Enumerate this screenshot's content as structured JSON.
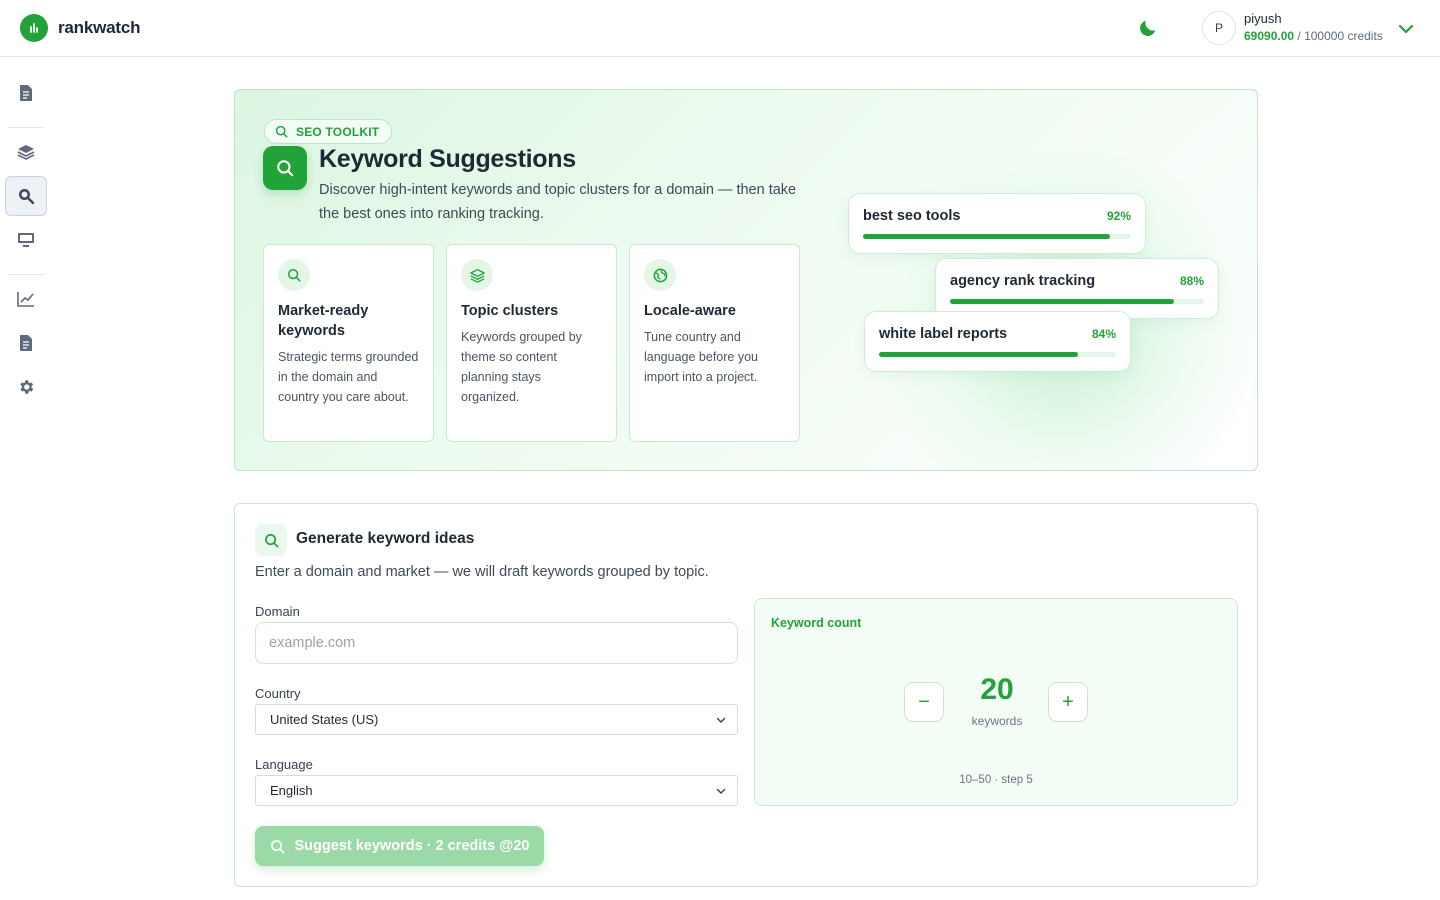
{
  "header": {
    "brand": "rankwatch",
    "user": {
      "initial": "P",
      "name": "piyush",
      "credits_used": "69090.00",
      "credits_total": "/ 100000 credits"
    }
  },
  "sidebar": {
    "items": [
      {
        "icon": "document-icon"
      },
      {
        "icon": "layers-icon"
      },
      {
        "icon": "keyword-search-icon",
        "active": true
      },
      {
        "icon": "monitor-icon"
      },
      {
        "icon": "line-chart-icon"
      },
      {
        "icon": "report-icon"
      },
      {
        "icon": "gear-icon"
      }
    ]
  },
  "hero": {
    "pill": "SEO TOOLKIT",
    "title": "Keyword Suggestions",
    "subtitle": "Discover high-intent keywords and topic clusters for a domain — then take the best ones into ranking tracking.",
    "features": [
      {
        "title": "Market-ready keywords",
        "desc": "Strategic terms grounded in the domain and country you care about."
      },
      {
        "title": "Topic clusters",
        "desc": "Keywords grouped by theme so content planning stays organized."
      },
      {
        "title": "Locale-aware",
        "desc": "Tune country and language before you import into a project."
      }
    ],
    "preview": [
      {
        "keyword": "best seo tools",
        "score": "92%",
        "value": 0.92
      },
      {
        "keyword": "agency rank tracking",
        "score": "88%",
        "value": 0.88
      },
      {
        "keyword": "white label reports",
        "score": "84%",
        "value": 0.84
      }
    ]
  },
  "generate": {
    "title": "Generate keyword ideas",
    "subtitle": "Enter a domain and market — we will draft keywords grouped by topic.",
    "domain_label": "Domain",
    "domain_placeholder": "example.com",
    "country_label": "Country",
    "country_value": "United States (US)",
    "language_label": "Language",
    "language_value": "English",
    "keyword_count_label": "Keyword count",
    "keyword_count": "20",
    "keyword_unit": "keywords",
    "range_text": "10–50 · step 5",
    "decrement": "−",
    "increment": "+",
    "submit_label": "Suggest keywords · 2 credits @20"
  },
  "colors": {
    "accent": "#22a33a",
    "accent_light": "#9bd9a6"
  }
}
